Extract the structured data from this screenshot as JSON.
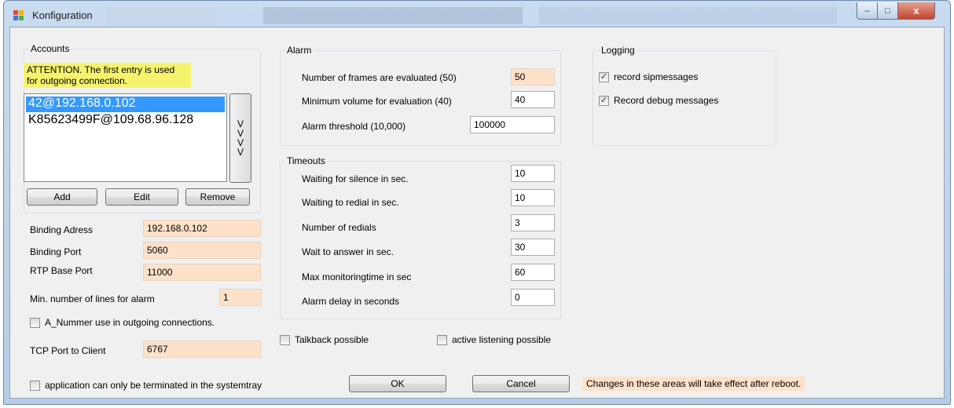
{
  "window": {
    "title": "Konfiguration",
    "controls": {
      "minimize": "–",
      "maximize": "□",
      "close": "x"
    }
  },
  "accounts": {
    "legend": "Accounts",
    "attention": "ATTENTION. The first entry is used for outgoing connection.",
    "entries": [
      "42@192.168.0.102",
      "K85623499F@109.68.96.128"
    ],
    "selected_index": 0,
    "move_label": "V V V V",
    "add": "Add",
    "edit": "Edit",
    "remove": "Remove"
  },
  "binding": {
    "address_label": "Binding Adress",
    "address_value": "192.168.0.102",
    "port_label": "Binding Port",
    "port_value": "5060",
    "rtp_label": "RTP Base Port",
    "rtp_value": "11000",
    "min_lines_label": "Min. number of lines for alarm",
    "min_lines_value": "1",
    "a_nummer_label": "A_Nummer use in outgoing connections.",
    "a_nummer_checked": false,
    "tcp_label": "TCP Port to Client",
    "tcp_value": "6767",
    "systray_label": "application can only be terminated in the systemtray",
    "systray_checked": false
  },
  "alarm": {
    "legend": "Alarm",
    "frames_label": "Number of frames are evaluated (50)",
    "frames_value": "50",
    "min_volume_label": "Minimum volume for evaluation (40)",
    "min_volume_value": "40",
    "threshold_label": "Alarm threshold (10,000)",
    "threshold_value": "100000"
  },
  "timeouts": {
    "legend": "Timeouts",
    "rows": [
      {
        "label": "Waiting for silence in sec.",
        "value": "10"
      },
      {
        "label": "Waiting to redial in sec.",
        "value": "10"
      },
      {
        "label": "Number of redials",
        "value": "3"
      },
      {
        "label": "Wait to answer in sec.",
        "value": "30"
      },
      {
        "label": "Max monitoringtime in sec",
        "value": "60"
      },
      {
        "label": "Alarm delay in seconds",
        "value": "0"
      }
    ]
  },
  "options": {
    "talkback_label": "Talkback possible",
    "talkback_checked": false,
    "listening_label": "active listening possible",
    "listening_checked": false
  },
  "logging": {
    "legend": "Logging",
    "sip_label": "record sipmessages",
    "sip_checked": true,
    "debug_label": "Record debug messages",
    "debug_checked": true
  },
  "footer": {
    "ok": "OK",
    "cancel": "Cancel",
    "notice": "Changes in these areas will take effect after reboot."
  },
  "colors": {
    "highlight_peach": "#fde1c9",
    "attention_yellow": "#f7f26e",
    "selection_blue": "#3399ff",
    "close_red": "#c4442e"
  }
}
